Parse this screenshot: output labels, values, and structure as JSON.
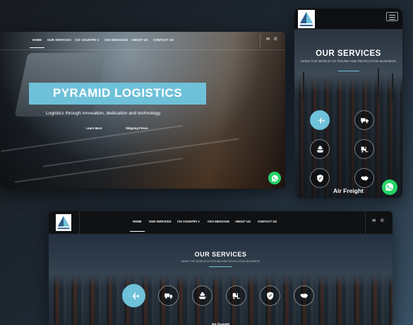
{
  "nav": {
    "items": [
      "HOME",
      "OUR SERVICES",
      "CIS COUNTRY ▾",
      "CEO MESSAGE",
      "ABOUT US",
      "CONTACT US"
    ],
    "active": "HOME"
  },
  "hero": {
    "title": "PYRAMID LOGISTICS",
    "tagline": "Logistics through innovation, dedication and technology.",
    "cta_learn": "Learn More",
    "cta_shipping": "Shipping Prices"
  },
  "services": {
    "title": "OUR SERVICES",
    "subtitle": "MAKE THE WORLD GO ROUND AND REVOLUTION BUSINESS",
    "active_label": "Air Freight",
    "icons": [
      "plane-icon",
      "truck-icon",
      "ship-icon",
      "forklift-icon",
      "shield-icon",
      "handshake-icon"
    ]
  },
  "colors": {
    "accent": "#6ec1d8",
    "whatsapp": "#25d366",
    "header_bg": "#0f1113"
  }
}
